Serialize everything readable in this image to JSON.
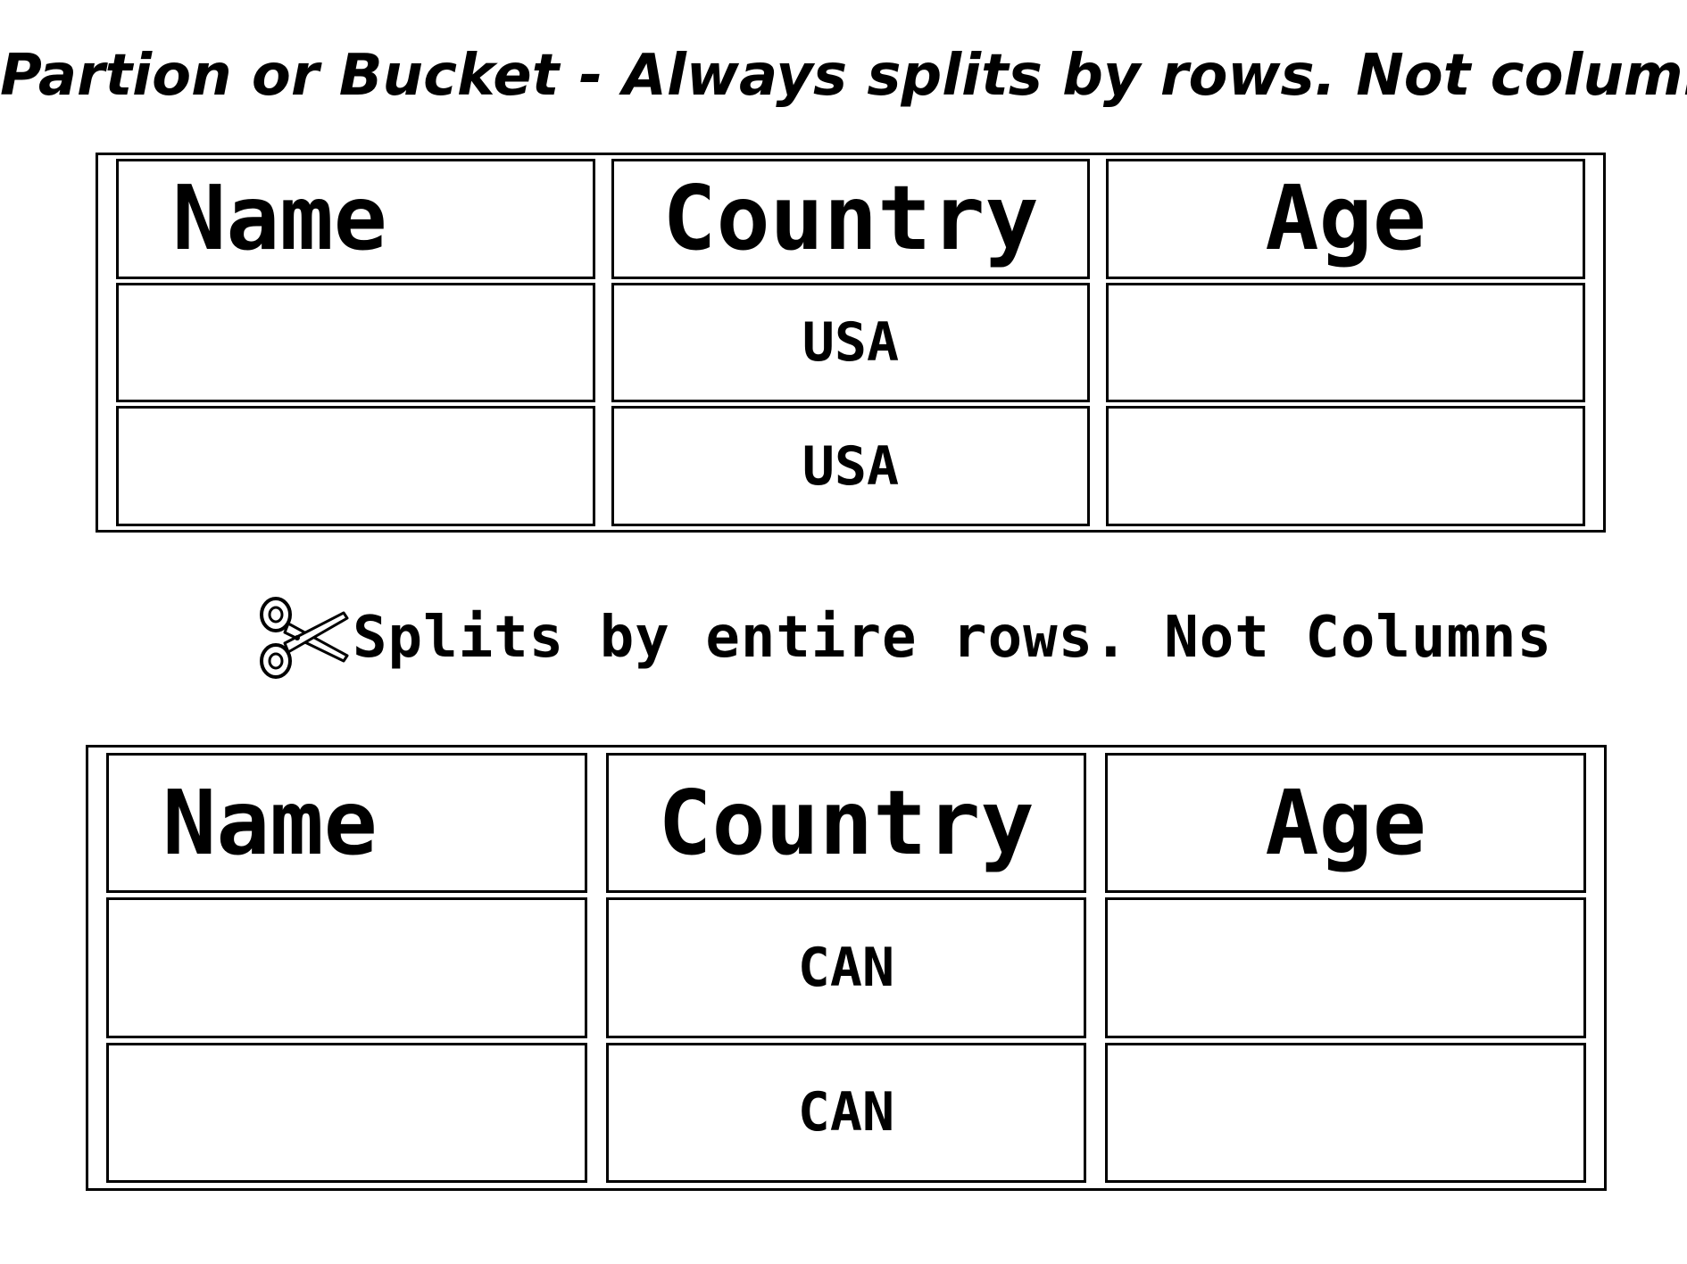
{
  "title": "Partion or Bucket - Always splits by rows. Not columns",
  "caption": {
    "icon": "scissors-icon",
    "text": "Splits by entire rows. Not Columns"
  },
  "tables": [
    {
      "headers": [
        "Name",
        "Country",
        "Age"
      ],
      "rows": [
        [
          "",
          "USA",
          ""
        ],
        [
          "",
          "USA",
          ""
        ]
      ]
    },
    {
      "headers": [
        "Name",
        "Country",
        "Age"
      ],
      "rows": [
        [
          "",
          "CAN",
          ""
        ],
        [
          "",
          "CAN",
          ""
        ]
      ]
    }
  ]
}
